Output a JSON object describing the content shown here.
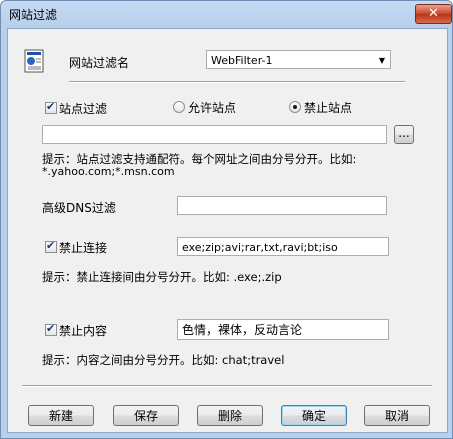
{
  "window": {
    "title": "网站过滤",
    "close_label": "✕"
  },
  "filter_name": {
    "label": "网站过滤名",
    "value": "WebFilter-1"
  },
  "site_filter": {
    "label": "站点过滤",
    "allow_label": "允许站点",
    "deny_label": "禁止站点",
    "selected": "deny",
    "value": "",
    "browse_label": "...",
    "hint_line1": "提示：站点过滤支持通配符。每个网址之间由分号分开。比如:",
    "hint_line2": "*.yahoo.com;*.msn.com"
  },
  "dns_filter": {
    "label": "高级DNS过滤",
    "value": ""
  },
  "block_connect": {
    "label": "禁止连接",
    "value": "exe;zip;avi;rar,txt,ravi;bt;iso",
    "hint": "提示：禁止连接间由分号分开。比如:  .exe;.zip"
  },
  "block_content": {
    "label": "禁止内容",
    "value": "色情，裸体，反动言论",
    "hint": "提示：内容之间由分号分开。比如:  chat;travel"
  },
  "buttons": {
    "new": "新建",
    "save": "保存",
    "delete": "删除",
    "ok": "确定",
    "cancel": "取消"
  }
}
